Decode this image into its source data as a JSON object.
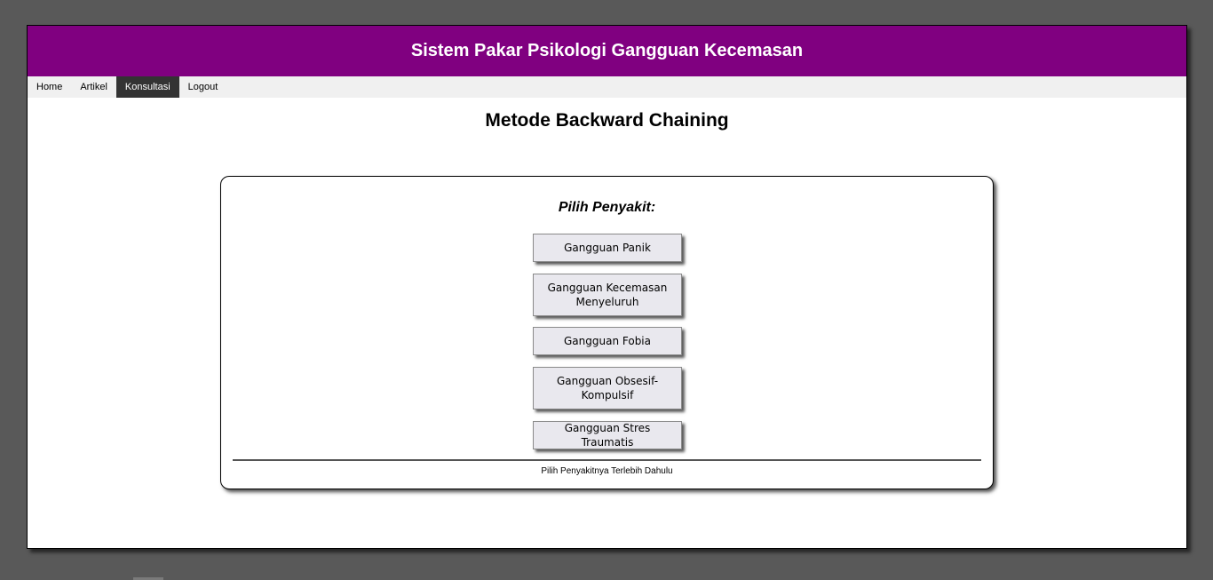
{
  "header": {
    "title": "Sistem Pakar Psikologi Gangguan Kecemasan"
  },
  "nav": {
    "items": [
      {
        "label": "Home"
      },
      {
        "label": "Artikel"
      },
      {
        "label": "Konsultasi"
      },
      {
        "label": "Logout"
      }
    ],
    "active": "Konsultasi"
  },
  "main": {
    "title": "Metode Backward Chaining",
    "panel": {
      "heading": "Pilih Penyakit:",
      "options": [
        {
          "label": "Gangguan Panik"
        },
        {
          "label": "Gangguan Kecemasan Menyeluruh"
        },
        {
          "label": "Gangguan Fobia"
        },
        {
          "label": "Gangguan Obsesif-Kompulsif"
        },
        {
          "label": "Gangguan Stres Traumatis"
        }
      ],
      "footer": "Pilih Penyakitnya Terlebih Dahulu"
    }
  },
  "colors": {
    "header_bg": "#800080",
    "nav_active_bg": "#333333",
    "page_bg": "#595959"
  }
}
